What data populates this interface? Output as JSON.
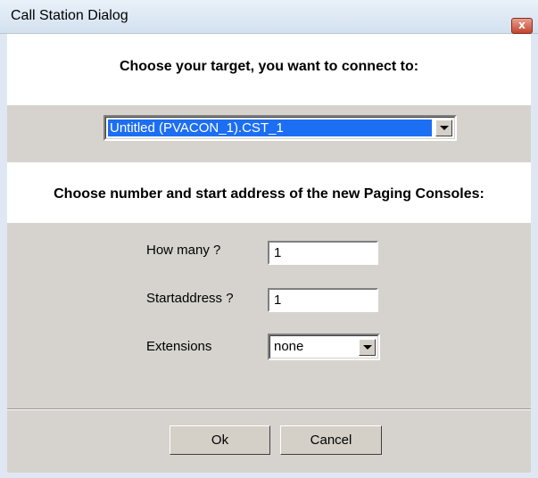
{
  "window": {
    "title": "Call Station Dialog",
    "close_glyph": "x"
  },
  "target_section": {
    "heading": "Choose your target, you want to connect to:",
    "selected_value": "Untitled (PVACON_1).CST_1"
  },
  "paging_section": {
    "heading": "Choose number and start address of the new Paging Consoles:",
    "how_many_label": "How many ?",
    "how_many_value": "1",
    "startaddress_label": "Startaddress ?",
    "startaddress_value": "1",
    "extensions_label": "Extensions",
    "extensions_value": "none"
  },
  "buttons": {
    "ok": "Ok",
    "cancel": "Cancel"
  },
  "colors": {
    "dialog_bg": "#d6d3ce",
    "selection": "#1c6ef2",
    "close_button": "#c2452d"
  },
  "icons": [
    "close-icon",
    "chevron-down-icon"
  ]
}
